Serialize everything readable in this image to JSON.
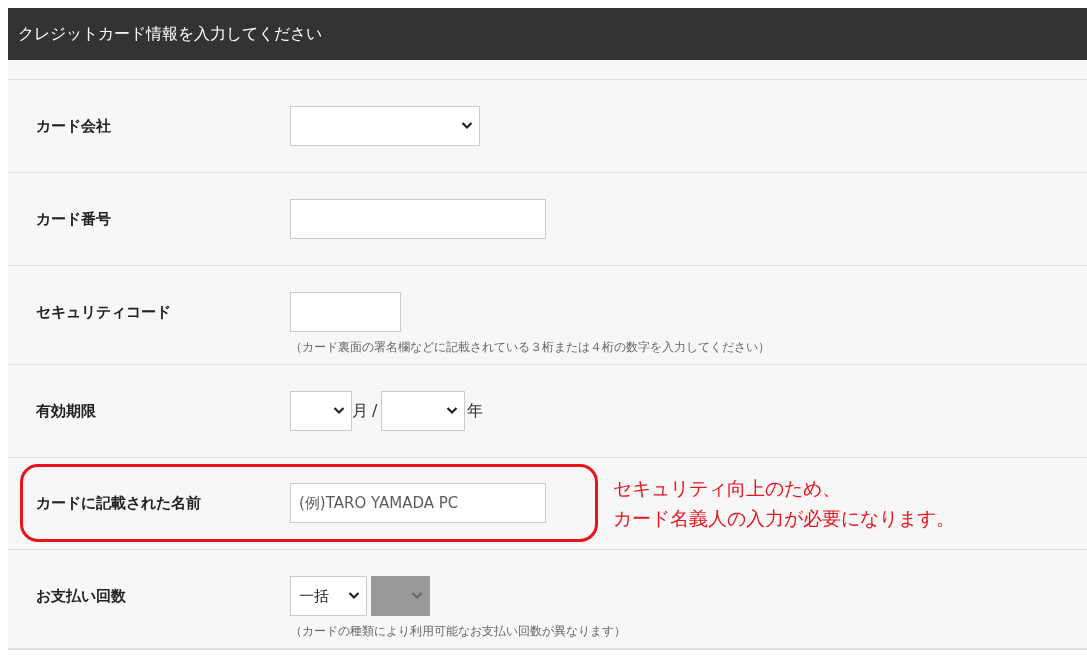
{
  "panel": {
    "title": "クレジットカード情報を入力してください"
  },
  "rows": [
    {
      "label": "カード会社",
      "kind": "select",
      "highlighted": false
    },
    {
      "label": "カード番号",
      "kind": "input",
      "highlighted": false
    },
    {
      "label": "セキュリティコード",
      "kind": "code",
      "help": "（カード裏面の署名欄などに記載されている３桁または４桁の数字を入力してください）",
      "highlighted": false
    },
    {
      "label": "有効期限",
      "kind": "expiry",
      "month_unit": "月",
      "separator": "/",
      "year_unit": "年",
      "highlighted": false
    },
    {
      "label": "カードに記載された名前",
      "kind": "input",
      "placeholder": "(例)TARO YAMADA PC",
      "highlighted": true,
      "note_lines": [
        "セキュリティ向上のため、",
        "カード名義人の入力が必要になります。"
      ]
    },
    {
      "label": "お支払い回数",
      "kind": "installments",
      "value": "一括",
      "second_disabled": true,
      "help": "（カードの種類により利用可能なお支払い回数が異なります）",
      "highlighted": false
    }
  ]
}
